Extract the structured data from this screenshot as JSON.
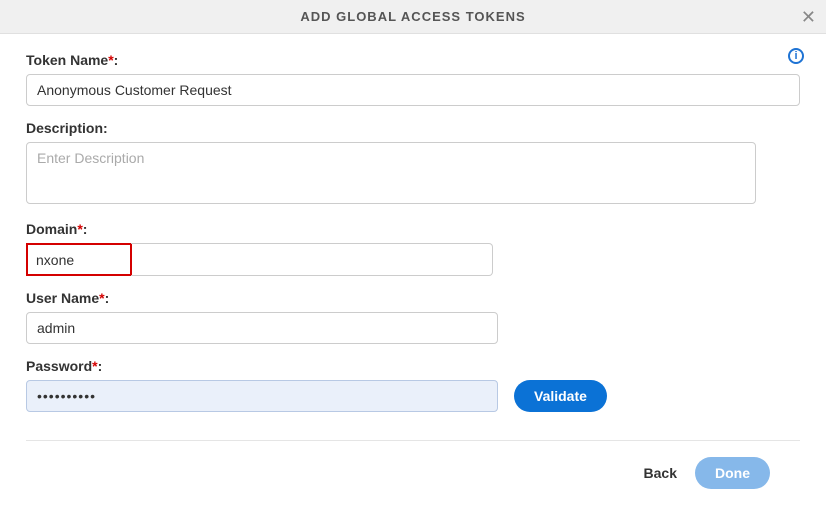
{
  "header": {
    "title": "ADD GLOBAL ACCESS TOKENS",
    "close_icon": "✕",
    "info_icon": "i"
  },
  "fields": {
    "token_name": {
      "label": "Token Name",
      "required_mark": "*",
      "colon": ":",
      "value": "Anonymous Customer Request"
    },
    "description": {
      "label": "Description:",
      "placeholder": "Enter Description",
      "value": ""
    },
    "domain": {
      "label": "Domain",
      "required_mark": "*",
      "colon": ":",
      "value": "nxone"
    },
    "user_name": {
      "label": "User Name",
      "required_mark": "*",
      "colon": ":",
      "value": "admin"
    },
    "password": {
      "label": "Password",
      "required_mark": "*",
      "colon": ":",
      "value": "••••••••••"
    }
  },
  "buttons": {
    "validate": "Validate",
    "back": "Back",
    "done": "Done"
  }
}
